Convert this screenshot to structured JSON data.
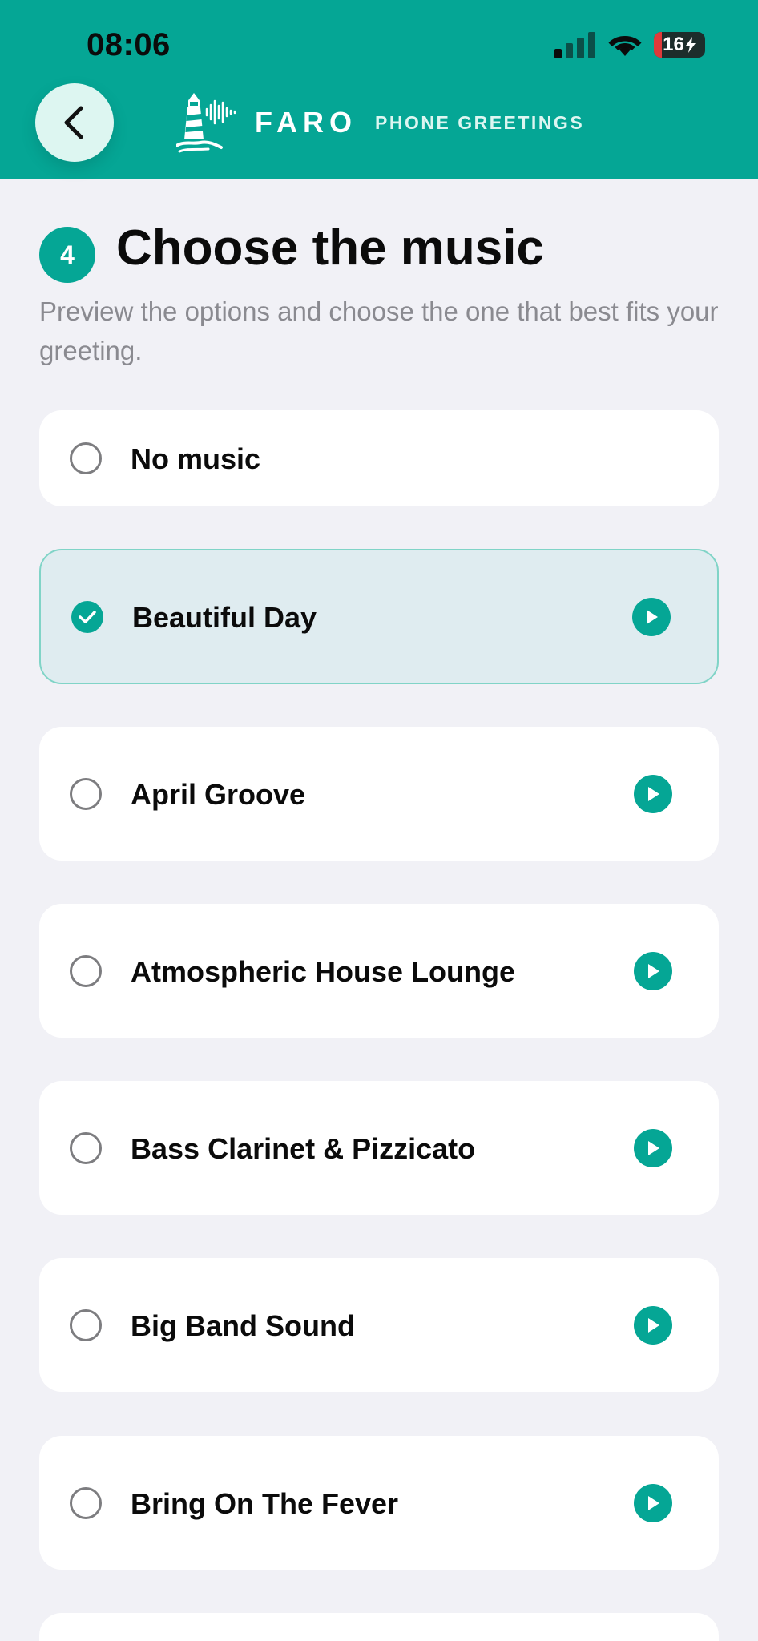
{
  "status_bar": {
    "time": "08:06",
    "battery_percent": "16",
    "battery_level": 0.16,
    "battery_fill_color": "#E03A3A",
    "signal_bars_active": 1,
    "signal_bars_total": 4,
    "icons": [
      "cellular-signal-icon",
      "wifi-icon",
      "battery-charging-icon"
    ]
  },
  "header": {
    "back_icon": "chevron-left-icon",
    "logo_icon": "lighthouse-soundwave-icon",
    "brand": "FARO",
    "tagline": "PHONE GREETINGS",
    "background_color": "#05A695"
  },
  "step": {
    "number": "4",
    "title": "Choose the music",
    "subtitle": "Preview the options and choose the one that best fits your greeting."
  },
  "options": [
    {
      "label": "No music",
      "selected": false,
      "has_preview": false
    },
    {
      "label": "Beautiful Day",
      "selected": true,
      "has_preview": true
    },
    {
      "label": "April Groove",
      "selected": false,
      "has_preview": true
    },
    {
      "label": "Atmospheric House Lounge",
      "selected": false,
      "has_preview": true
    },
    {
      "label": "Bass Clarinet & Pizzicato",
      "selected": false,
      "has_preview": true
    },
    {
      "label": "Big Band Sound",
      "selected": false,
      "has_preview": true
    },
    {
      "label": "Bring On The Fever",
      "selected": false,
      "has_preview": true
    }
  ],
  "colors": {
    "accent": "#05A695",
    "selected_background": "#DFECF0",
    "selected_border": "#80D4C7",
    "page_background": "#F1F1F6"
  }
}
